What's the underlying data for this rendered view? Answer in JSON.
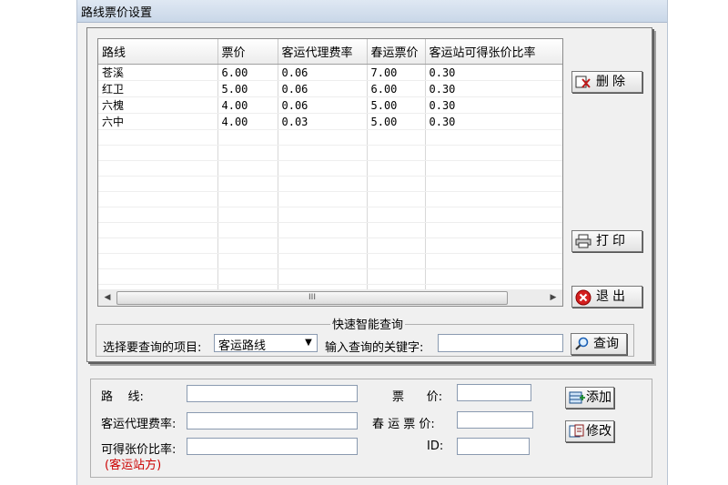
{
  "window": {
    "title": "路线票价设置"
  },
  "grid": {
    "columns": [
      "路线",
      "票价",
      "客运代理费率",
      "春运票价",
      "客运站可得张价比率"
    ],
    "rows": [
      [
        "苍溪",
        "6.00",
        "0.06",
        "7.00",
        "0.30"
      ],
      [
        "红卫",
        "5.00",
        "0.06",
        "6.00",
        "0.30"
      ],
      [
        "六槐",
        "4.00",
        "0.06",
        "5.00",
        "0.30"
      ],
      [
        "六中",
        "4.00",
        "0.03",
        "5.00",
        "0.30"
      ]
    ],
    "scrollbar": {
      "thumb_grip": "III",
      "left_arrow": "◀",
      "right_arrow": "▶"
    }
  },
  "side_buttons": {
    "delete": "删除",
    "print": "打印",
    "exit": "退出"
  },
  "quick_query": {
    "title": "快速智能查询",
    "item_label": "选择要查询的项目:",
    "item_selected": "客运路线",
    "keyword_label": "输入查询的关键字:",
    "keyword_value": "",
    "query_button": "查询"
  },
  "form": {
    "route_label": "路    线:",
    "price_label": "票      价:",
    "agent_rate_label": "客运代理费率:",
    "spring_price_label": "春 运 票 价:",
    "ratio_label": "可得张价比率:",
    "ratio_note": "(客运站方)",
    "id_label": "ID:",
    "add_button": "添加",
    "edit_button": "修改",
    "route_value": "",
    "price_value": "",
    "agent_rate_value": "",
    "spring_price_value": "",
    "ratio_value": "",
    "id_value": ""
  },
  "colors": {
    "window_bg": "#f0f0f0",
    "note_red": "#cc0000",
    "exit_red": "#d42020"
  },
  "icons": {
    "delete": "delete-x-icon",
    "print": "printer-icon",
    "exit": "exit-x-icon",
    "query": "magnifier-icon",
    "add": "add-record-icon",
    "edit": "edit-record-icon"
  }
}
